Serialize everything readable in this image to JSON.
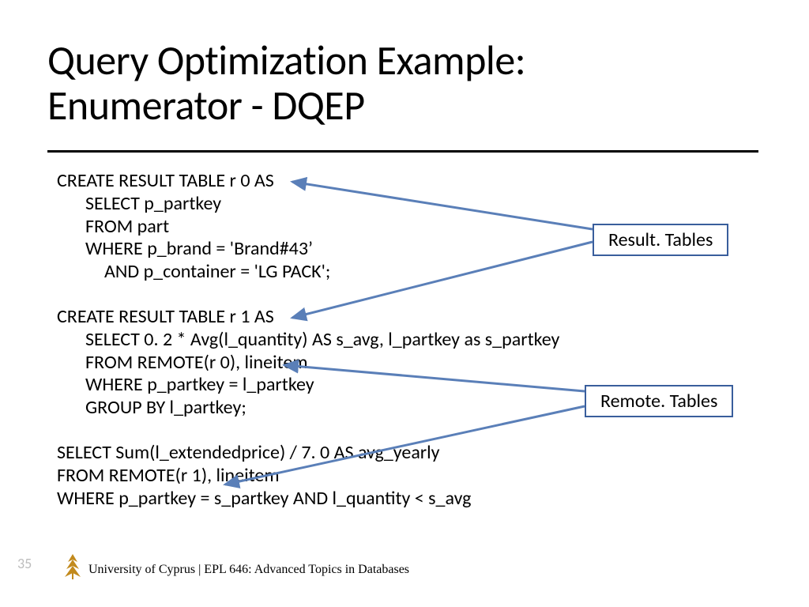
{
  "title_line1": "Query Optimization Example:",
  "title_line2": "Enumerator - DQEP",
  "sql": {
    "b1": {
      "l1": "CREATE RESULT TABLE r 0 AS",
      "l2": "SELECT p_partkey",
      "l3": "FROM part",
      "l4": "WHERE p_brand = 'Brand#43’",
      "l5": "AND p_container = 'LG PACK';"
    },
    "b2": {
      "l1": "CREATE RESULT TABLE r 1 AS",
      "l2": "SELECT 0. 2 * Avg(l_quantity) AS s_avg, l_partkey as s_partkey",
      "l3": "FROM REMOTE(r 0), lineitem",
      "l4": "WHERE p_partkey = l_partkey",
      "l5": "GROUP BY l_partkey;"
    },
    "b3": {
      "l1": "SELECT Sum(l_extendedprice) / 7. 0 AS avg_yearly",
      "l2": "FROM REMOTE(r 1),   lineitem",
      "l3": "WHERE p_partkey = s_partkey   AND l_quantity < s_avg"
    }
  },
  "box1": "Result. Tables",
  "box2": "Remote. Tables",
  "pagenum": "35",
  "footer": "University of Cyprus | EPL 646: Advanced Topics in Databases"
}
